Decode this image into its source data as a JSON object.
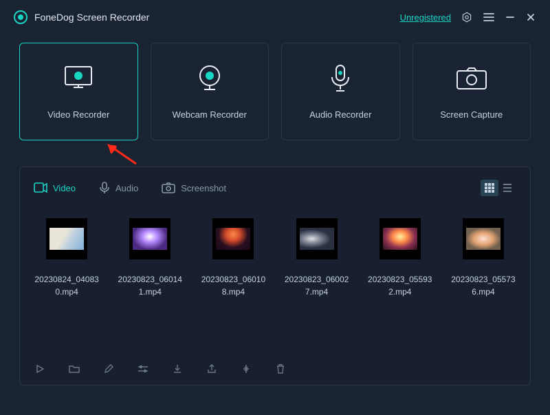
{
  "titlebar": {
    "app_name": "FoneDog Screen Recorder",
    "unregistered_label": "Unregistered"
  },
  "modes": [
    {
      "label": "Video Recorder",
      "selected": true
    },
    {
      "label": "Webcam Recorder",
      "selected": false
    },
    {
      "label": "Audio Recorder",
      "selected": false
    },
    {
      "label": "Screen Capture",
      "selected": false
    }
  ],
  "file_tabs": {
    "video": "Video",
    "audio": "Audio",
    "screenshot": "Screenshot",
    "active": "video"
  },
  "files": [
    {
      "name": "20230824_040830.mp4"
    },
    {
      "name": "20230823_060141.mp4"
    },
    {
      "name": "20230823_060108.mp4"
    },
    {
      "name": "20230823_060027.mp4"
    },
    {
      "name": "20230823_055932.mp4"
    },
    {
      "name": "20230823_055736.mp4"
    }
  ],
  "toolbar_icons": [
    "play-icon",
    "folder-icon",
    "edit-icon",
    "settings-icon",
    "download-icon",
    "share-icon",
    "cut-icon",
    "trash-icon"
  ],
  "colors": {
    "accent": "#19d6c4",
    "bg": "#1a2332",
    "panel": "#18202f",
    "border": "#2a3647"
  }
}
